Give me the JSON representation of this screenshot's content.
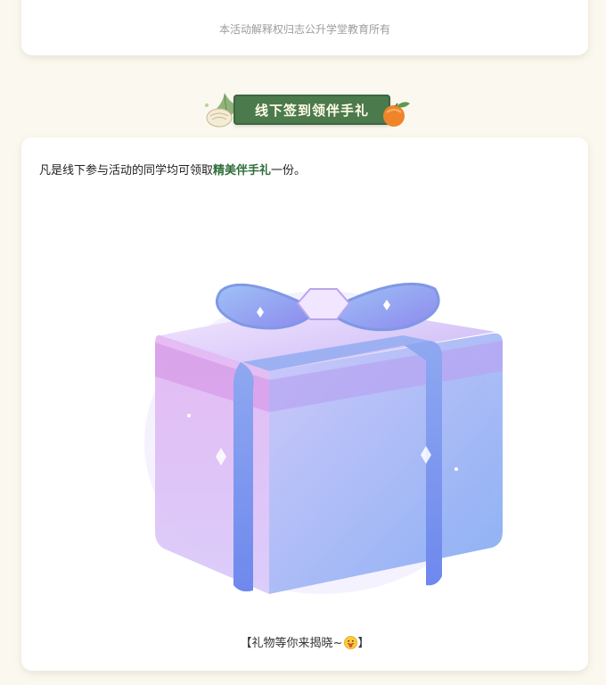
{
  "top_card": {
    "copyright": "本活动解释权归志公升学堂教育所有"
  },
  "section": {
    "banner_title": "线下签到领伴手礼",
    "intro_prefix": "凡是线下参与活动的同学均可领取",
    "intro_highlight": "精美伴手礼",
    "intro_suffix": "一份。",
    "caption_open": "【礼物等你来揭晓~",
    "caption_close": "】"
  },
  "colors": {
    "background": "#fbf8ef",
    "banner_green": "#4b7a4c",
    "highlight_green": "#2f6e39"
  },
  "icons": {
    "banner_left": "dumpling-leaf-decoration",
    "banner_right": "orange-fruit-decoration",
    "caption_emoji": "tongue-out-face-emoji",
    "main_image": "gift-box"
  }
}
